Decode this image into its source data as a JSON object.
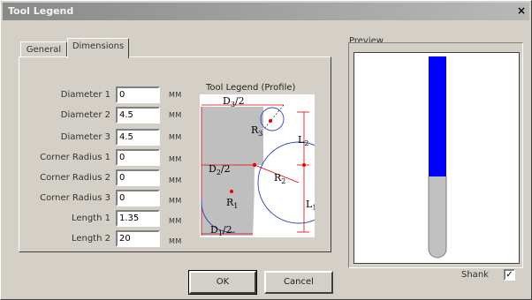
{
  "window": {
    "title": "Tool Legend",
    "close_glyph": "×"
  },
  "tabs": [
    {
      "label": "General",
      "active": false
    },
    {
      "label": "Dimensions",
      "active": true
    }
  ],
  "fields": [
    {
      "label": "Diameter 1",
      "value": "0",
      "unit": "MM"
    },
    {
      "label": "Diameter 2",
      "value": "4.5",
      "unit": "MM"
    },
    {
      "label": "Diameter 3",
      "value": "4.5",
      "unit": "MM"
    },
    {
      "label": "Corner Radius 1",
      "value": "0",
      "unit": "MM"
    },
    {
      "label": "Corner Radius 2",
      "value": "0",
      "unit": "MM"
    },
    {
      "label": "Corner Radius 3",
      "value": "0",
      "unit": "MM"
    },
    {
      "label": "Length 1",
      "value": "1.35",
      "unit": "MM"
    },
    {
      "label": "Length 2",
      "value": "20",
      "unit": "MM"
    }
  ],
  "legend": {
    "title": "Tool Legend (Profile)",
    "labels": {
      "d3": "D3/2",
      "d2": "D2/2",
      "d1": "D1/2",
      "r1": "R1",
      "r2": "R2",
      "r3": "R3",
      "l1": "L1",
      "l2": "L2"
    }
  },
  "preview": {
    "label": "Preview",
    "shank_label": "Shank",
    "shank_checked": true,
    "shank_color": "#0000ff",
    "flute_color": "#c0c0c0"
  },
  "buttons": {
    "ok": "OK",
    "cancel": "Cancel"
  }
}
